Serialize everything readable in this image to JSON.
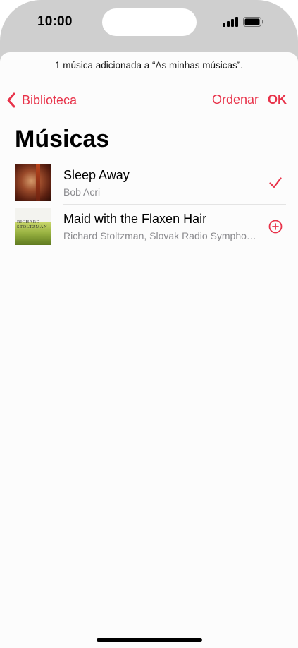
{
  "status_bar": {
    "time": "10:00",
    "signal_icon": "cellular-signal-icon",
    "battery_icon": "battery-icon"
  },
  "toast": {
    "message": "1 música adicionada a “As minhas músicas”."
  },
  "nav": {
    "back_label": "Biblioteca",
    "sort_label": "Ordenar",
    "done_label": "OK"
  },
  "page": {
    "title": "Músicas"
  },
  "songs": [
    {
      "title": "Sleep Away",
      "artist": "Bob Acri",
      "action_icon": "checkmark-icon",
      "added": true
    },
    {
      "title": "Maid with the Flaxen Hair",
      "artist": "Richard Stoltzman, Slovak Radio Symphony Orchestra",
      "action_icon": "add-circle-icon",
      "added": false,
      "art_text": [
        "RICHARD",
        "STOLTZMAN"
      ]
    }
  ],
  "colors": {
    "accent": "#e8334a",
    "secondary_text": "#8a8a8e",
    "separator": "#e4e4e4"
  }
}
